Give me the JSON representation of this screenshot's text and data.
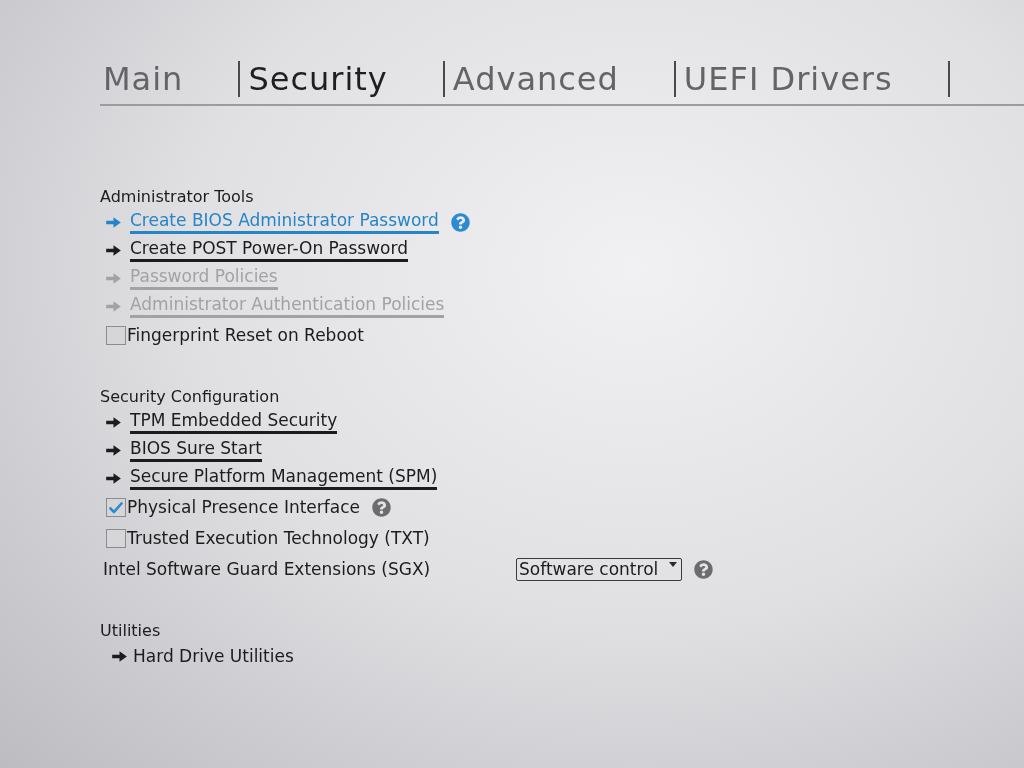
{
  "tabs": [
    {
      "label": "Main",
      "selected": false
    },
    {
      "label": "Security",
      "selected": true
    },
    {
      "label": "Advanced",
      "selected": false
    },
    {
      "label": "UEFI Drivers",
      "selected": false
    }
  ],
  "sections": [
    {
      "heading": "Administrator Tools",
      "items": [
        {
          "kind": "submenu",
          "label": "Create BIOS Administrator Password",
          "selected": true,
          "disabled": false,
          "help": true
        },
        {
          "kind": "submenu",
          "label": "Create POST Power-On Password",
          "selected": false,
          "disabled": false,
          "help": false
        },
        {
          "kind": "submenu",
          "label": "Password Policies",
          "selected": false,
          "disabled": true,
          "help": false
        },
        {
          "kind": "submenu",
          "label": "Administrator Authentication Policies",
          "selected": false,
          "disabled": true,
          "help": false
        },
        {
          "kind": "checkbox",
          "label": "Fingerprint Reset on Reboot",
          "checked": false,
          "selected": false,
          "disabled": false,
          "help": false
        }
      ]
    },
    {
      "heading": "Security Configuration",
      "items": [
        {
          "kind": "submenu",
          "label": "TPM Embedded Security",
          "selected": false,
          "disabled": false,
          "help": false
        },
        {
          "kind": "submenu",
          "label": "BIOS Sure Start",
          "selected": false,
          "disabled": false,
          "help": false
        },
        {
          "kind": "submenu",
          "label": "Secure Platform Management (SPM)",
          "selected": false,
          "disabled": false,
          "help": false
        },
        {
          "kind": "checkbox",
          "label": "Physical Presence Interface",
          "checked": true,
          "selected": false,
          "disabled": false,
          "help": true
        },
        {
          "kind": "checkbox",
          "label": "Trusted Execution Technology (TXT)",
          "checked": false,
          "selected": false,
          "disabled": false,
          "help": false
        },
        {
          "kind": "select",
          "label": "Intel Software Guard Extensions (SGX)",
          "value": "Software control",
          "selected": false,
          "disabled": false,
          "help": true
        }
      ]
    },
    {
      "heading": "Utilities",
      "items": [
        {
          "kind": "action",
          "label": "Hard Drive Utilities",
          "selected": false,
          "disabled": false,
          "help": false
        }
      ]
    }
  ]
}
